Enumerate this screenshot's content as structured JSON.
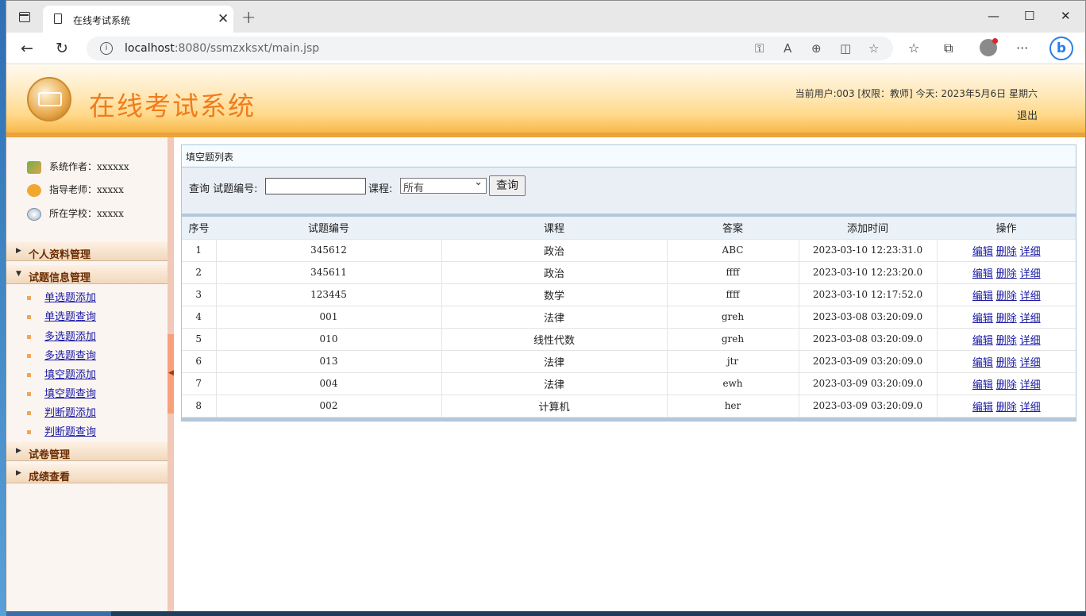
{
  "browser": {
    "tab_title": "在线考试系统",
    "url_host": "localhost",
    "url_rest": ":8080/ssmzxksxt/main.jsp"
  },
  "header": {
    "site_title": "在线考试系统",
    "user_info": "当前用户:003 [权限：教师] 今天: 2023年5月6日 星期六",
    "logout": "退出"
  },
  "sidebar": {
    "info": [
      {
        "label": "系统作者：xxxxxx"
      },
      {
        "label": "指导老师：xxxxx"
      },
      {
        "label": "所在学校：xxxxx"
      }
    ],
    "menus": {
      "personal": "个人资料管理",
      "questions": "试题信息管理",
      "papers": "试卷管理",
      "scores": "成绩查看"
    },
    "sub_items": [
      "单选题添加",
      "单选题查询",
      "多选题添加",
      "多选题查询",
      "填空题添加",
      "填空题查询",
      "判断题添加",
      "判断题查询"
    ]
  },
  "content": {
    "panel_title": "填空题列表",
    "search": {
      "prefix": "查询 试题编号:",
      "course_label": "课程:",
      "course_value": "所有",
      "button": "查询"
    },
    "columns": [
      "序号",
      "试题编号",
      "课程",
      "答案",
      "添加时间",
      "操作"
    ],
    "actions": [
      "编辑",
      "删除",
      "详细"
    ],
    "rows": [
      {
        "no": "1",
        "code": "345612",
        "course": "政治",
        "answer": "ABC",
        "time": "2023-03-10 12:23:31.0"
      },
      {
        "no": "2",
        "code": "345611",
        "course": "政治",
        "answer": "ffff",
        "time": "2023-03-10 12:23:20.0"
      },
      {
        "no": "3",
        "code": "123445",
        "course": "数学",
        "answer": "ffff",
        "time": "2023-03-10 12:17:52.0"
      },
      {
        "no": "4",
        "code": "001",
        "course": "法律",
        "answer": "greh",
        "time": "2023-03-08 03:20:09.0"
      },
      {
        "no": "5",
        "code": "010",
        "course": "线性代数",
        "answer": "greh",
        "time": "2023-03-08 03:20:09.0"
      },
      {
        "no": "6",
        "code": "013",
        "course": "法律",
        "answer": "jtr",
        "time": "2023-03-09 03:20:09.0"
      },
      {
        "no": "7",
        "code": "004",
        "course": "法律",
        "answer": "ewh",
        "time": "2023-03-09 03:20:09.0"
      },
      {
        "no": "8",
        "code": "002",
        "course": "计算机",
        "answer": "her",
        "time": "2023-03-09 03:20:09.0"
      }
    ]
  }
}
